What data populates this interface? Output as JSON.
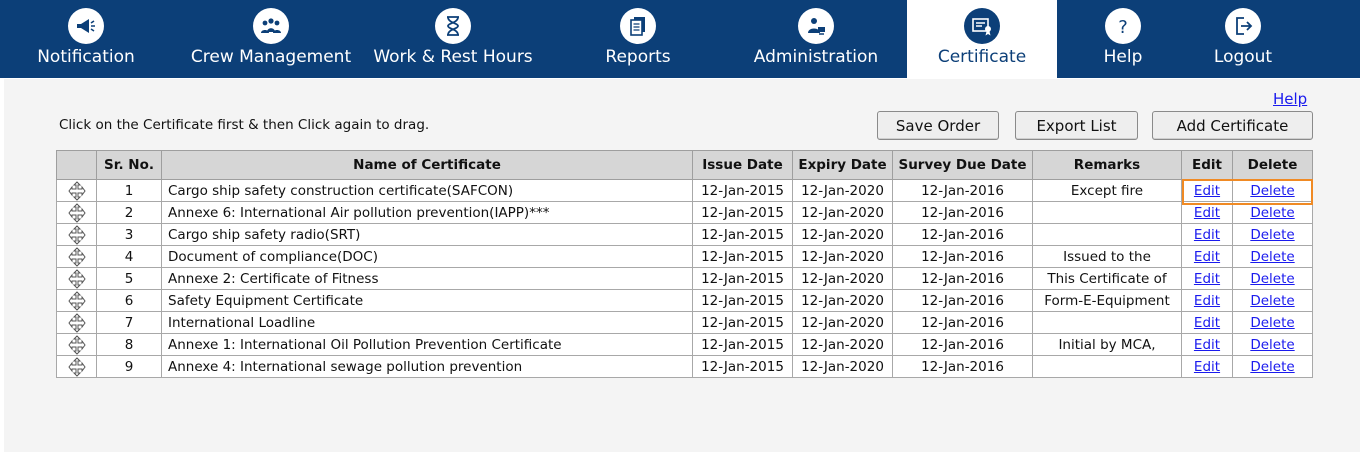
{
  "nav": {
    "items": [
      {
        "label": "Notification",
        "icon": "megaphone-icon"
      },
      {
        "label": "Crew Management",
        "icon": "crew-icon"
      },
      {
        "label": "Work & Rest Hours",
        "icon": "hourglass-icon"
      },
      {
        "label": "Reports",
        "icon": "reports-icon"
      },
      {
        "label": "Administration",
        "icon": "administration-icon"
      },
      {
        "label": "Certificate",
        "icon": "certificate-icon"
      },
      {
        "label": "Help",
        "icon": "question-icon"
      },
      {
        "label": "Logout",
        "icon": "logout-icon"
      }
    ],
    "active": "Certificate"
  },
  "toolbar": {
    "help_link": "Help",
    "instruction": "Click on the Certificate first & then Click again to drag.",
    "save_order": "Save Order",
    "export_list": "Export List",
    "add_certificate": "Add Certificate"
  },
  "table": {
    "headers": [
      "",
      "Sr. No.",
      "Name of Certificate",
      "Issue Date",
      "Expiry Date",
      "Survey Due Date",
      "Remarks",
      "Edit",
      "Delete"
    ],
    "edit_label": "Edit",
    "delete_label": "Delete",
    "rows": [
      {
        "sr": "1",
        "name": "Cargo ship safety construction certificate(SAFCON)",
        "issue": "12-Jan-2015",
        "expiry": "12-Jan-2020",
        "survey": "12-Jan-2016",
        "remarks": "Except fire"
      },
      {
        "sr": "2",
        "name": "Annexe 6: International Air pollution prevention(IAPP)***",
        "issue": "12-Jan-2015",
        "expiry": "12-Jan-2020",
        "survey": "12-Jan-2016",
        "remarks": ""
      },
      {
        "sr": "3",
        "name": "Cargo ship safety radio(SRT)",
        "issue": "12-Jan-2015",
        "expiry": "12-Jan-2020",
        "survey": "12-Jan-2016",
        "remarks": ""
      },
      {
        "sr": "4",
        "name": "Document of compliance(DOC)",
        "issue": "12-Jan-2015",
        "expiry": "12-Jan-2020",
        "survey": "12-Jan-2016",
        "remarks": "Issued to the"
      },
      {
        "sr": "5",
        "name": "Annexe 2: Certificate of Fitness",
        "issue": "12-Jan-2015",
        "expiry": "12-Jan-2020",
        "survey": "12-Jan-2016",
        "remarks": "This Certificate of"
      },
      {
        "sr": "6",
        "name": "Safety Equipment Certificate",
        "issue": "12-Jan-2015",
        "expiry": "12-Jan-2020",
        "survey": "12-Jan-2016",
        "remarks": "Form-E-Equipment"
      },
      {
        "sr": "7",
        "name": "International Loadline",
        "issue": "12-Jan-2015",
        "expiry": "12-Jan-2020",
        "survey": "12-Jan-2016",
        "remarks": ""
      },
      {
        "sr": "8",
        "name": "Annexe 1: International Oil Pollution Prevention Certificate",
        "issue": "12-Jan-2015",
        "expiry": "12-Jan-2020",
        "survey": "12-Jan-2016",
        "remarks": "Initial by MCA,"
      },
      {
        "sr": "9",
        "name": "Annexe 4: International sewage pollution prevention",
        "issue": "12-Jan-2015",
        "expiry": "12-Jan-2020",
        "survey": "12-Jan-2016",
        "remarks": ""
      }
    ]
  },
  "colors": {
    "nav_bg": "#0c3f78",
    "link": "#1a1aee",
    "highlight": "#f08a24"
  }
}
